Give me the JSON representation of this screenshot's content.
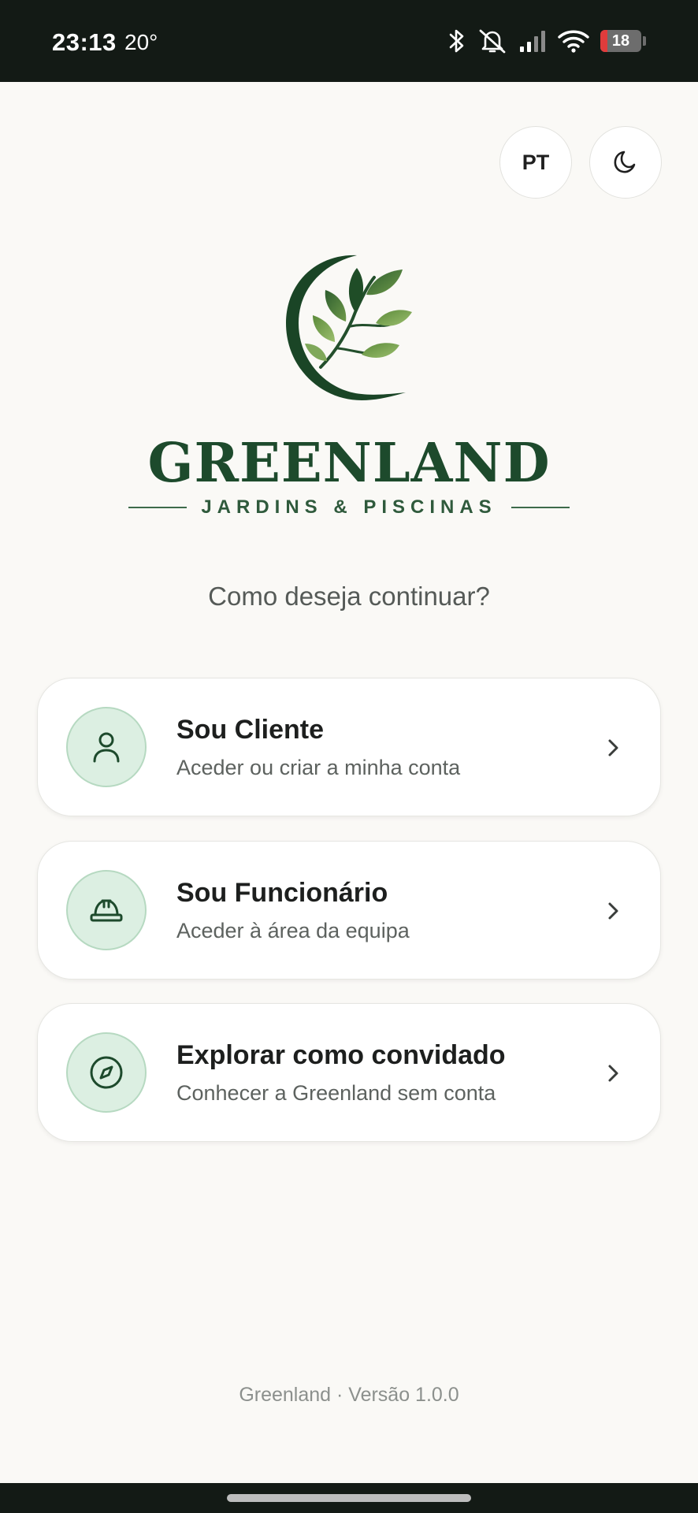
{
  "status_bar": {
    "time": "23:13",
    "temperature": "20°",
    "battery": 18,
    "icons": [
      "bluetooth-icon",
      "bell-off-icon",
      "signal-icon",
      "wifi-icon",
      "battery-icon"
    ]
  },
  "header": {
    "language_label": "PT",
    "theme_icon": "moon-icon"
  },
  "brand": {
    "name": "GREENLAND",
    "tagline": "JARDINS & PISCINAS",
    "colors": {
      "primary": "#1d4a2c",
      "accent": "#dcefe2"
    }
  },
  "question": "Como deseja continuar?",
  "options": [
    {
      "title": "Sou Cliente",
      "subtitle": "Aceder ou criar a minha conta",
      "icon": "user-icon"
    },
    {
      "title": "Sou Funcionário",
      "subtitle": "Aceder à área da equipa",
      "icon": "hard-hat-icon"
    },
    {
      "title": "Explorar como convidado",
      "subtitle": "Conhecer a Greenland sem conta",
      "icon": "compass-icon"
    }
  ],
  "footer": {
    "version": "Greenland · Versão 1.0.0"
  }
}
